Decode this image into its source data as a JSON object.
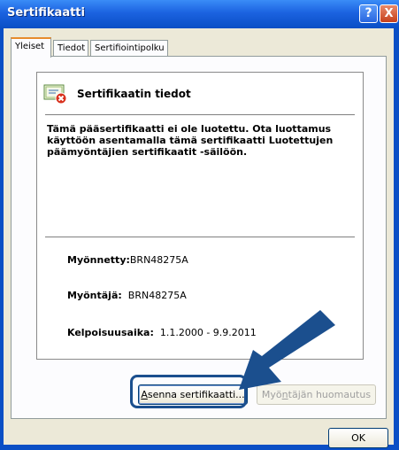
{
  "window": {
    "title": "Sertifikaatti",
    "help_label": "?",
    "close_label": "X"
  },
  "tabs": [
    {
      "label": "Yleiset"
    },
    {
      "label": "Tiedot"
    },
    {
      "label": "Sertifiointipolku"
    }
  ],
  "general": {
    "header": "Sertifikaatin tiedot",
    "warning": "Tämä pääsertifikaatti ei ole luotettu. Ota luottamus käyttöön asentamalla tämä sertifikaatti Luotettujen päämyöntäjien sertifikaatit -säilöön.",
    "issued_to_label": "Myönnetty:",
    "issued_to_value": "BRN48275A",
    "issued_by_label": "Myöntäjä:",
    "issued_by_value": "BRN48275A",
    "validity_label": "Kelpoisuusaika:",
    "validity_value": "1.1.2000 - 9.9.2011"
  },
  "buttons": {
    "install_prefix": "A",
    "install_rest": "senna sertifikaatti...",
    "issuer_statement_prefix": "Myö",
    "issuer_statement_accel": "n",
    "issuer_statement_rest": "täjän huomautus",
    "ok": "OK"
  },
  "colors": {
    "titlebar": "#0a4fc5",
    "dialog_bg": "#ece9d8",
    "annotation": "#1b4f8e"
  },
  "icons": [
    "help-icon",
    "close-icon",
    "certificate-error-icon",
    "annotation-arrow"
  ]
}
